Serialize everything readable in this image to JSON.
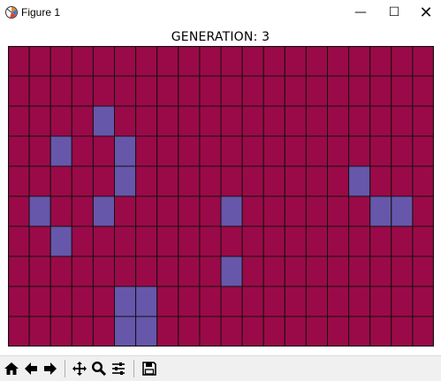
{
  "window": {
    "title": "Figure 1",
    "controls": {
      "minimize": "—",
      "maximize": "☐",
      "close": "✕"
    }
  },
  "plot": {
    "title": "GENERATION: 3"
  },
  "colors": {
    "dead_cell": "#9b0a48",
    "live_cell": "#6657aa",
    "grid_line": "#111111"
  },
  "grid": {
    "rows": 10,
    "cols": 20,
    "live_cells": [
      [
        2,
        4
      ],
      [
        3,
        2
      ],
      [
        3,
        5
      ],
      [
        4,
        5
      ],
      [
        4,
        16
      ],
      [
        5,
        1
      ],
      [
        5,
        4
      ],
      [
        5,
        10
      ],
      [
        5,
        17
      ],
      [
        5,
        18
      ],
      [
        6,
        2
      ],
      [
        7,
        10
      ],
      [
        8,
        5
      ],
      [
        8,
        6
      ],
      [
        9,
        5
      ],
      [
        9,
        6
      ]
    ]
  },
  "toolbar": {
    "buttons": [
      {
        "name": "home-button",
        "icon": "home-icon"
      },
      {
        "name": "back-button",
        "icon": "arrow-left-icon"
      },
      {
        "name": "forward-button",
        "icon": "arrow-right-icon"
      },
      {
        "name": "pan-button",
        "icon": "move-icon"
      },
      {
        "name": "zoom-button",
        "icon": "magnifier-icon"
      },
      {
        "name": "configure-subplots-button",
        "icon": "sliders-icon"
      },
      {
        "name": "save-button",
        "icon": "floppy-disk-icon"
      }
    ]
  }
}
